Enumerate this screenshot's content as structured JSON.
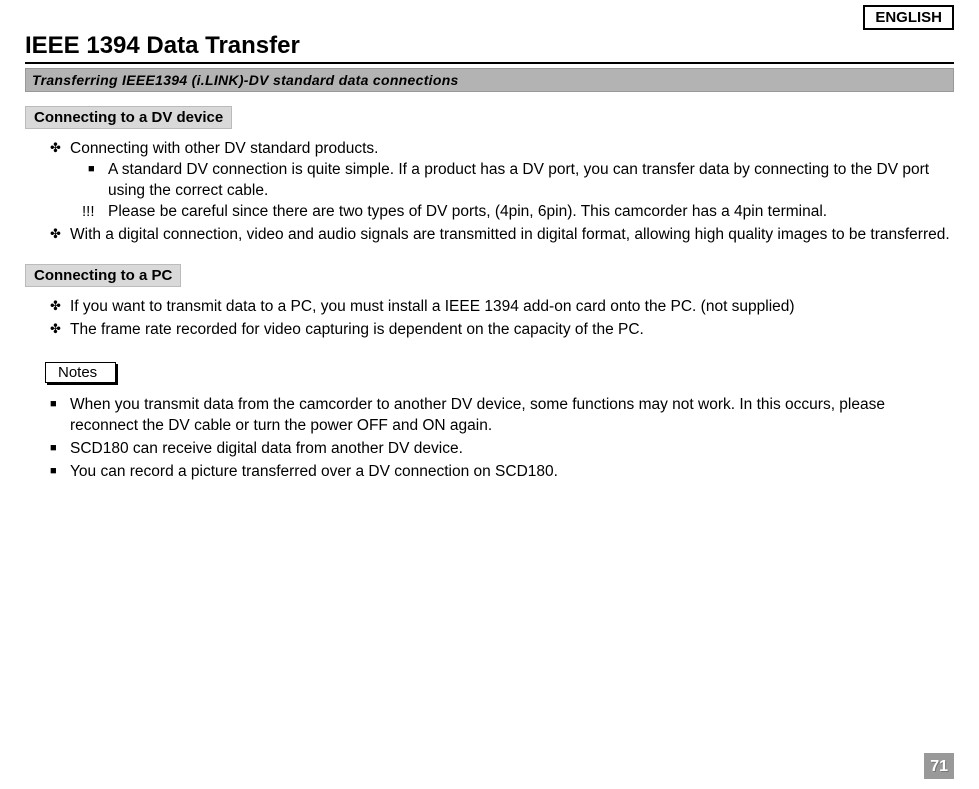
{
  "language_tag": "ENGLISH",
  "page_title": "IEEE 1394 Data Transfer",
  "subtitle": "Transferring IEEE1394 (i.LINK)-DV standard data connections",
  "section1": {
    "heading": "Connecting to a DV device",
    "item1": "Connecting with other DV standard products.",
    "item1_sub_a": "A standard DV connection is quite simple. If a product has a DV port, you can transfer data by connecting to the DV port using the correct cable.",
    "item1_sub_b": "Please be careful since there are two types of DV ports, (4pin, 6pin). This camcorder has a 4pin terminal.",
    "item2": "With a digital connection, video and audio signals are transmitted in digital format, allowing high quality images to be transferred."
  },
  "section2": {
    "heading": "Connecting to a PC",
    "item1": "If you want to transmit data to a PC, you must install a IEEE 1394 add-on card onto the PC. (not supplied)",
    "item2": "The frame rate recorded for video capturing is dependent on the capacity of the PC."
  },
  "notes": {
    "label": "Notes",
    "item1": "When you transmit data from the camcorder to another DV device, some functions may not work. In this occurs, please reconnect the DV cable or turn the power OFF and ON again.",
    "item2": "SCD180 can receive digital data from another DV device.",
    "item3": "You can record a picture transferred over a DV connection on SCD180."
  },
  "page_number": "71"
}
